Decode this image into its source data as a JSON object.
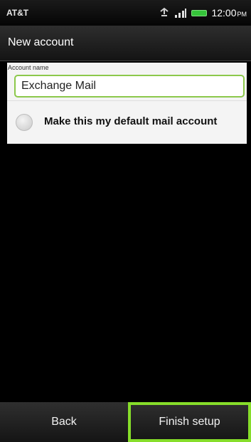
{
  "status_bar": {
    "carrier": "AT&T",
    "time": "12:00",
    "time_suffix": "PM",
    "battery_color": "#35c43a",
    "icons": [
      "data-sync-icon",
      "signal-bars-icon",
      "battery-icon"
    ]
  },
  "header": {
    "title": "New account"
  },
  "form": {
    "account_name_label": "Account name",
    "account_name_value": "Exchange Mail",
    "default_account_label": "Make this my default mail account",
    "default_account_checked": false
  },
  "footer": {
    "back_label": "Back",
    "finish_label": "Finish setup",
    "highlight_color": "#86dd2a"
  }
}
